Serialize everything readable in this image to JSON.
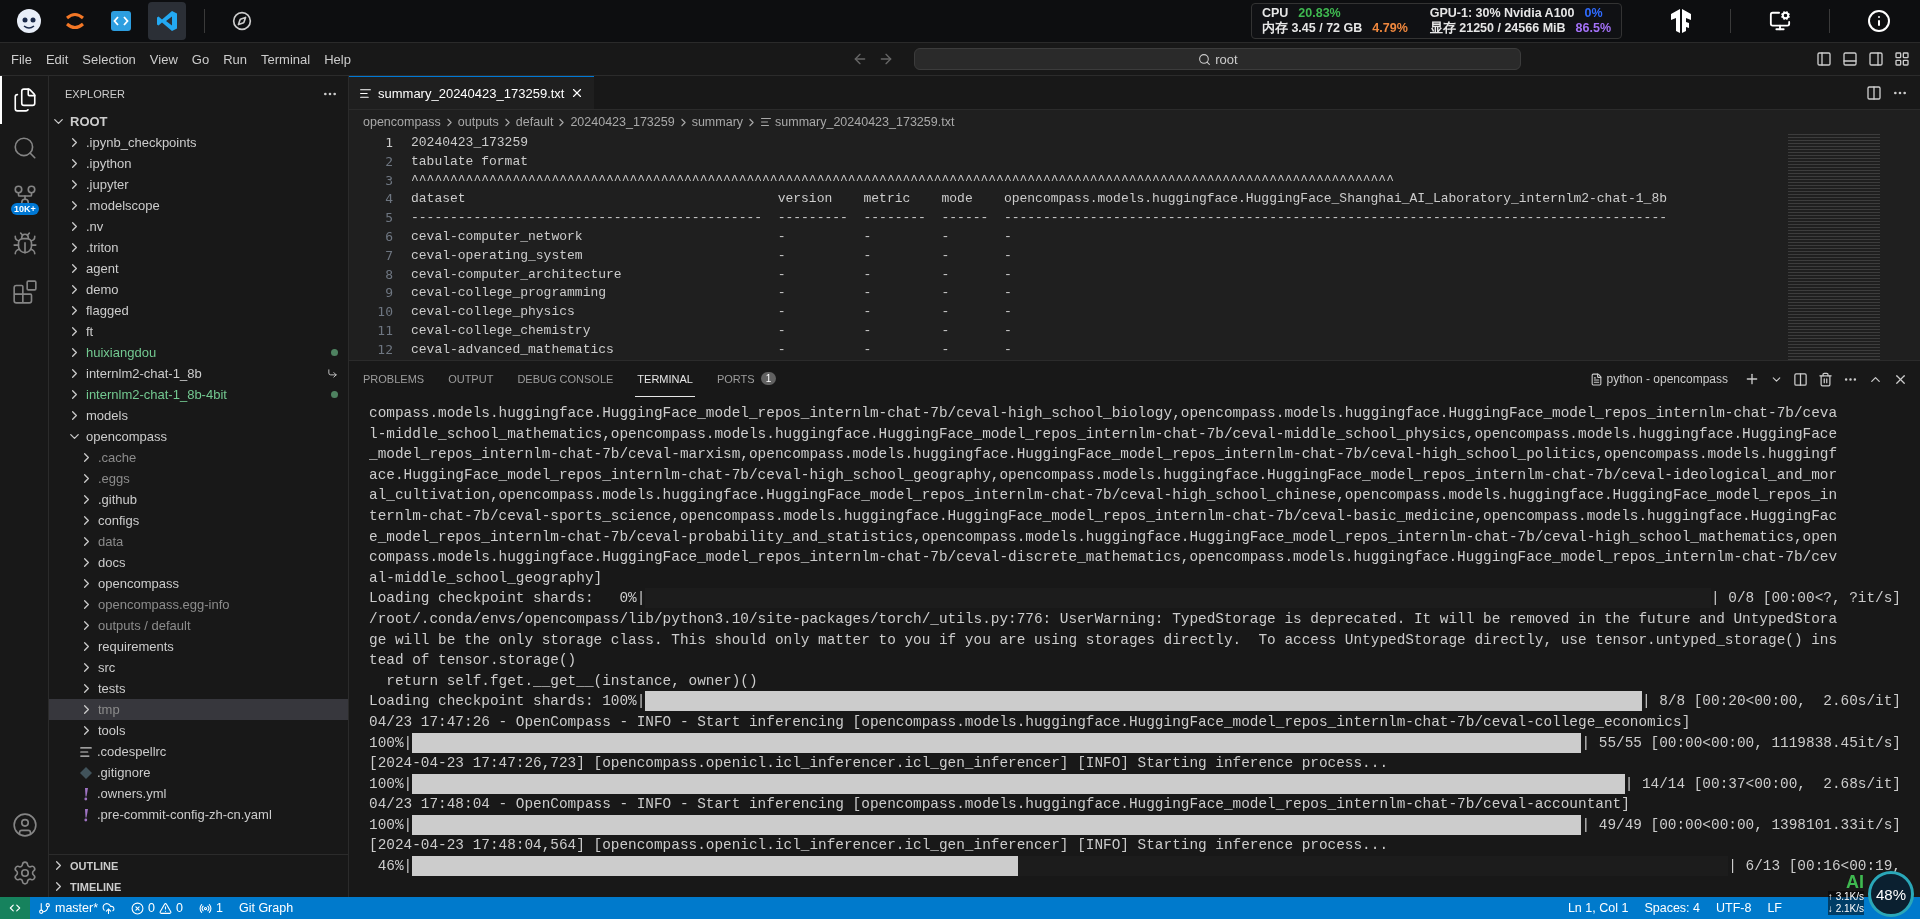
{
  "top_bar": {
    "apps": [
      {
        "kind": "mascot",
        "selected": false
      },
      {
        "kind": "arcs",
        "selected": false
      },
      {
        "kind": "code",
        "selected": false
      },
      {
        "kind": "editor",
        "selected": true
      },
      {
        "kind": "compass",
        "selected": false
      }
    ],
    "stats": [
      {
        "label": "CPU",
        "value": "20.83%",
        "color": "#3fb950"
      },
      {
        "label": "GPU-1: 30% Nvidia A100",
        "value": "0%",
        "color": "#2f6bff"
      },
      {
        "label": "内存 3.45 / 72 GB",
        "value": "4.79%",
        "color": "#f0883e"
      },
      {
        "label": "显存 21250 / 24566 MiB",
        "value": "86.5%",
        "color": "#a371f7"
      }
    ]
  },
  "menu": [
    "File",
    "Edit",
    "Selection",
    "View",
    "Go",
    "Run",
    "Terminal",
    "Help"
  ],
  "command_center": {
    "value": "root"
  },
  "activity_bar": {
    "items": [
      {
        "kind": "explorer",
        "selected": true
      },
      {
        "kind": "search",
        "selected": false
      },
      {
        "kind": "source-control",
        "selected": false,
        "badge": "10K+"
      },
      {
        "kind": "run-debug",
        "selected": false
      },
      {
        "kind": "extensions",
        "selected": false
      }
    ],
    "bottom": [
      {
        "kind": "accounts"
      },
      {
        "kind": "settings"
      }
    ]
  },
  "sidebar": {
    "title": "EXPLORER",
    "root": {
      "label": "ROOT",
      "expanded": true
    },
    "tree": [
      {
        "name": ".ipynb_checkpoints",
        "kind": "folder",
        "expanded": false,
        "selected": false
      },
      {
        "name": ".ipython",
        "kind": "folder",
        "expanded": false,
        "selected": false
      },
      {
        "name": ".jupyter",
        "kind": "folder",
        "expanded": false,
        "selected": false
      },
      {
        "name": ".modelscope",
        "kind": "folder",
        "expanded": false,
        "selected": false
      },
      {
        "name": ".nv",
        "kind": "folder",
        "expanded": false,
        "selected": false
      },
      {
        "name": ".triton",
        "kind": "folder",
        "expanded": false,
        "selected": false
      },
      {
        "name": "agent",
        "kind": "folder",
        "expanded": false,
        "selected": false
      },
      {
        "name": "demo",
        "kind": "folder",
        "expanded": false,
        "selected": false
      },
      {
        "name": "flagged",
        "kind": "folder",
        "expanded": false,
        "selected": false
      },
      {
        "name": "ft",
        "kind": "folder",
        "expanded": false,
        "selected": false
      },
      {
        "name": "huixiangdou",
        "kind": "untracked-folder",
        "expanded": false,
        "selected": false
      },
      {
        "name": "internlm2-chat-1_8b",
        "kind": "linked-folder",
        "expanded": false,
        "selected": false
      },
      {
        "name": "internlm2-chat-1_8b-4bit",
        "kind": "untracked-folder",
        "expanded": false,
        "selected": false
      },
      {
        "name": "models",
        "kind": "folder",
        "expanded": false,
        "selected": false
      },
      {
        "name": "opencompass",
        "kind": "folder",
        "expanded": true,
        "selected": false,
        "children": [
          {
            "name": ".cache",
            "kind": "ignored-folder",
            "expanded": false,
            "selected": false
          },
          {
            "name": ".eggs",
            "kind": "ignored-folder",
            "expanded": false,
            "selected": false
          },
          {
            "name": ".github",
            "kind": "folder",
            "expanded": false,
            "selected": false
          },
          {
            "name": "configs",
            "kind": "folder",
            "expanded": false,
            "selected": false
          },
          {
            "name": "data",
            "kind": "ignored-folder",
            "expanded": false,
            "selected": false
          },
          {
            "name": "docs",
            "kind": "folder",
            "expanded": false,
            "selected": false
          },
          {
            "name": "opencompass",
            "kind": "folder",
            "expanded": false,
            "selected": false
          },
          {
            "name": "opencompass.egg-info",
            "kind": "ignored-folder",
            "expanded": false,
            "selected": false
          },
          {
            "name": "outputs / default",
            "kind": "ignored-folder",
            "expanded": false,
            "selected": false
          },
          {
            "name": "requirements",
            "kind": "folder",
            "expanded": false,
            "selected": false
          },
          {
            "name": "src",
            "kind": "folder",
            "expanded": false,
            "selected": false
          },
          {
            "name": "tests",
            "kind": "folder",
            "expanded": false,
            "selected": false
          },
          {
            "name": "tmp",
            "kind": "ignored-folder",
            "expanded": false,
            "selected": true
          },
          {
            "name": "tools",
            "kind": "folder",
            "expanded": false,
            "selected": false
          },
          {
            "name": ".codespellrc",
            "kind": "text-file",
            "selected": false
          },
          {
            "name": ".gitignore",
            "kind": "git-file",
            "selected": false
          },
          {
            "name": ".owners.yml",
            "kind": "yaml-file",
            "selected": false
          },
          {
            "name": ".pre-commit-config-zh-cn.yaml",
            "kind": "yaml-file",
            "selected": false
          }
        ]
      }
    ],
    "sections": [
      {
        "label": "OUTLINE",
        "expanded": false
      },
      {
        "label": "TIMELINE",
        "expanded": false
      }
    ]
  },
  "editor": {
    "tabs": [
      {
        "label": "summary_20240423_173259.txt",
        "selected": true
      }
    ],
    "breadcrumbs": [
      "opencompass",
      "outputs",
      "default",
      "20240423_173259",
      "summary",
      "summary_20240423_173259.txt"
    ],
    "lines": [
      {
        "number": "1",
        "text": "20240423_173259",
        "active": true
      },
      {
        "number": "2",
        "text": "tabulate format",
        "active": false
      },
      {
        "number": "3",
        "text": "^^^^^^^^^^^^^^^^^^^^^^^^^^^^^^^^^^^^^^^^^^^^^^^^^^^^^^^^^^^^^^^^^^^^^^^^^^^^^^^^^^^^^^^^^^^^^^^^^^^^^^^^^^^^^^^^^^^^^^^^^^^^^^",
        "active": false
      },
      {
        "number": "4",
        "text": "dataset                                        version    metric    mode    opencompass.models.huggingface.HuggingFace_Shanghai_AI_Laboratory_internlm2-chat-1_8b",
        "active": false
      },
      {
        "number": "5",
        "text": "---------------------------------------------  ---------  --------  ------  -------------------------------------------------------------------------------------",
        "active": false
      },
      {
        "number": "6",
        "text": "ceval-computer_network                         -          -         -       -",
        "active": false
      },
      {
        "number": "7",
        "text": "ceval-operating_system                         -          -         -       -",
        "active": false
      },
      {
        "number": "8",
        "text": "ceval-computer_architecture                    -          -         -       -",
        "active": false
      },
      {
        "number": "9",
        "text": "ceval-college_programming                      -          -         -       -",
        "active": false
      },
      {
        "number": "10",
        "text": "ceval-college_physics                          -          -         -       -",
        "active": false
      },
      {
        "number": "11",
        "text": "ceval-college_chemistry                        -          -         -       -",
        "active": false
      },
      {
        "number": "12",
        "text": "ceval-advanced_mathematics                     -          -         -       -",
        "active": false
      }
    ]
  },
  "panel": {
    "tabs": [
      {
        "label": "PROBLEMS",
        "selected": false
      },
      {
        "label": "OUTPUT",
        "selected": false
      },
      {
        "label": "DEBUG CONSOLE",
        "selected": false
      },
      {
        "label": "TERMINAL",
        "selected": true
      },
      {
        "label": "PORTS",
        "selected": false,
        "badge": "1"
      }
    ],
    "terminal_title": "python - opencompass",
    "lines": [
      {
        "kind": "text",
        "text": "compass.models.huggingface.HuggingFace_model_repos_internlm-chat-7b/ceval-high_school_biology,opencompass.models.huggingface.HuggingFace_model_repos_internlm-chat-7b/ceva"
      },
      {
        "kind": "text",
        "text": "l-middle_school_mathematics,opencompass.models.huggingface.HuggingFace_model_repos_internlm-chat-7b/ceval-middle_school_physics,opencompass.models.huggingface.HuggingFace"
      },
      {
        "kind": "text",
        "text": "_model_repos_internlm-chat-7b/ceval-marxism,opencompass.models.huggingface.HuggingFace_model_repos_internlm-chat-7b/ceval-high_school_politics,opencompass.models.huggingf"
      },
      {
        "kind": "text",
        "text": "ace.HuggingFace_model_repos_internlm-chat-7b/ceval-high_school_geography,opencompass.models.huggingface.HuggingFace_model_repos_internlm-chat-7b/ceval-ideological_and_mor"
      },
      {
        "kind": "text",
        "text": "al_cultivation,opencompass.models.huggingface.HuggingFace_model_repos_internlm-chat-7b/ceval-high_school_chinese,opencompass.models.huggingface.HuggingFace_model_repos_in"
      },
      {
        "kind": "text",
        "text": "ternlm-chat-7b/ceval-sports_science,opencompass.models.huggingface.HuggingFace_model_repos_internlm-chat-7b/ceval-basic_medicine,opencompass.models.huggingface.HuggingFac"
      },
      {
        "kind": "text",
        "text": "e_model_repos_internlm-chat-7b/ceval-probability_and_statistics,opencompass.models.huggingface.HuggingFace_model_repos_internlm-chat-7b/ceval-high_school_mathematics,open"
      },
      {
        "kind": "text",
        "text": "compass.models.huggingface.HuggingFace_model_repos_internlm-chat-7b/ceval-discrete_mathematics,opencompass.models.huggingface.HuggingFace_model_repos_internlm-chat-7b/cev"
      },
      {
        "kind": "text",
        "text": "al-middle_school_geography]"
      },
      {
        "kind": "progress",
        "prefix": "Loading checkpoint shards:   0%|",
        "level": 0,
        "suffix": "| 0/8 [00:00<?, ?it/s]"
      },
      {
        "kind": "text",
        "text": "/root/.conda/envs/opencompass/lib/python3.10/site-packages/torch/_utils.py:776: UserWarning: TypedStorage is deprecated. It will be removed in the future and UntypedStora"
      },
      {
        "kind": "text",
        "text": "ge will be the only storage class. This should only matter to you if you are using storages directly.  To access UntypedStorage directly, use tensor.untyped_storage() ins"
      },
      {
        "kind": "text",
        "text": "tead of tensor.storage()"
      },
      {
        "kind": "text",
        "text": "  return self.fget.__get__(instance, owner)()"
      },
      {
        "kind": "progress",
        "prefix": "Loading checkpoint shards: 100%|",
        "level": 1,
        "suffix": "| 8/8 [00:20<00:00,  2.60s/it]"
      },
      {
        "kind": "text",
        "text": "04/23 17:47:26 - OpenCompass - INFO - Start inferencing [opencompass.models.huggingface.HuggingFace_model_repos_internlm-chat-7b/ceval-college_economics]"
      },
      {
        "kind": "progress",
        "prefix": "100%|",
        "level": 1,
        "suffix": "| 55/55 [00:00<00:00, 1119838.45it/s]"
      },
      {
        "kind": "text",
        "text": "[2024-04-23 17:47:26,723] [opencompass.openicl.icl_inferencer.icl_gen_inferencer] [INFO] Starting inference process..."
      },
      {
        "kind": "progress",
        "prefix": "100%|",
        "level": 1,
        "suffix": "| 14/14 [00:37<00:00,  2.68s/it]"
      },
      {
        "kind": "text",
        "text": "04/23 17:48:04 - OpenCompass - INFO - Start inferencing [opencompass.models.huggingface.HuggingFace_model_repos_internlm-chat-7b/ceval-accountant]"
      },
      {
        "kind": "progress",
        "prefix": "100%|",
        "level": 1,
        "suffix": "| 49/49 [00:00<00:00, 1398101.33it/s]"
      },
      {
        "kind": "text",
        "text": "[2024-04-23 17:48:04,564] [opencompass.openicl.icl_inferencer.icl_gen_inferencer] [INFO] Starting inference process..."
      },
      {
        "kind": "progress",
        "prefix": " 46%|",
        "level": 0.46,
        "suffix": "| 6/13 [00:16<00:19,"
      }
    ]
  },
  "status_bar": {
    "branch": "master*",
    "errors": "0",
    "warnings": "0",
    "ports": "1",
    "git_graph": "Git Graph",
    "right": [
      "Ln 1, Col 1",
      "Spaces: 4",
      "UTF-8",
      "LF"
    ]
  },
  "net_widget": {
    "label": "AI",
    "up": "↑ 3.1K/s",
    "down": "↓ 2.1K/s",
    "percent": "48%"
  }
}
